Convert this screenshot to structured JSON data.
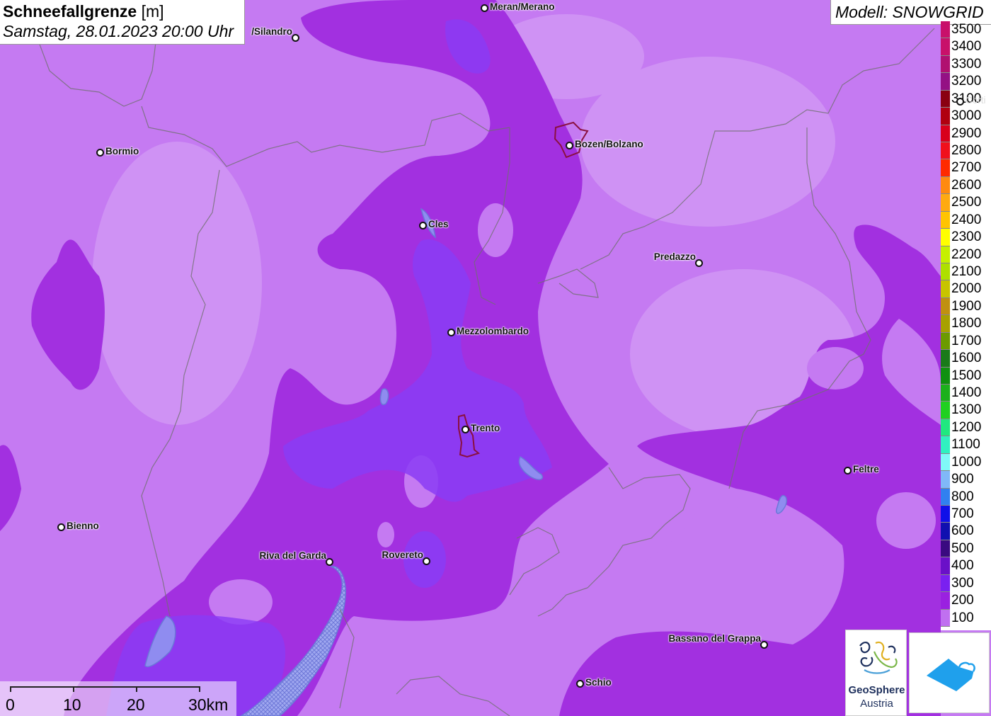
{
  "title": {
    "main": "Schneefallgrenze",
    "unit": "[m]",
    "date": "Samstag, 28.01.2023 20:00 Uhr"
  },
  "model_label": "Modell: SNOWGRID",
  "legend": [
    {
      "label": "3500",
      "color": "#c8106a"
    },
    {
      "label": "3400",
      "color": "#c8106a"
    },
    {
      "label": "3300",
      "color": "#b01070"
    },
    {
      "label": "3200",
      "color": "#941084"
    },
    {
      "label": "3100",
      "color": "#8a0010"
    },
    {
      "label": "3000",
      "color": "#b00010"
    },
    {
      "label": "2900",
      "color": "#d8001c"
    },
    {
      "label": "2800",
      "color": "#f0101c"
    },
    {
      "label": "2700",
      "color": "#ff2a00"
    },
    {
      "label": "2600",
      "color": "#ff8a10"
    },
    {
      "label": "2500",
      "color": "#ffaa10"
    },
    {
      "label": "2400",
      "color": "#ffc400"
    },
    {
      "label": "2300",
      "color": "#ffff00"
    },
    {
      "label": "2200",
      "color": "#c6f000"
    },
    {
      "label": "2100",
      "color": "#aee000"
    },
    {
      "label": "2000",
      "color": "#c8c400"
    },
    {
      "label": "1900",
      "color": "#c09010"
    },
    {
      "label": "1800",
      "color": "#a8a000"
    },
    {
      "label": "1700",
      "color": "#6c9a00"
    },
    {
      "label": "1600",
      "color": "#1a7a1a"
    },
    {
      "label": "1500",
      "color": "#109010"
    },
    {
      "label": "1400",
      "color": "#1cb01c"
    },
    {
      "label": "1300",
      "color": "#20d020"
    },
    {
      "label": "1200",
      "color": "#20e880"
    },
    {
      "label": "1100",
      "color": "#30f0c0"
    },
    {
      "label": "1000",
      "color": "#80f8f8"
    },
    {
      "label": "900",
      "color": "#80b8f8"
    },
    {
      "label": "800",
      "color": "#3080f0"
    },
    {
      "label": "700",
      "color": "#1010e8"
    },
    {
      "label": "600",
      "color": "#1010b0"
    },
    {
      "label": "500",
      "color": "#3a0a80"
    },
    {
      "label": "400",
      "color": "#6a10c8"
    },
    {
      "label": "300",
      "color": "#7a20f0"
    },
    {
      "label": "200",
      "color": "#9a20e0"
    },
    {
      "label": "100",
      "color": "#c070f0"
    }
  ],
  "cities": [
    {
      "name": "Meran/Merano"
    },
    {
      "name": "/Silandro"
    },
    {
      "name": "Bormio"
    },
    {
      "name": "Bozen/Bolzano"
    },
    {
      "name": "Cles"
    },
    {
      "name": "Predazzo"
    },
    {
      "name": "Mezzolombardo"
    },
    {
      "name": "Trento"
    },
    {
      "name": "Feltre"
    },
    {
      "name": "Bienno"
    },
    {
      "name": "Riva del Garda"
    },
    {
      "name": "Rovereto"
    },
    {
      "name": "Bassano del Grappa"
    },
    {
      "name": "Schio"
    },
    {
      "name": "Corti"
    }
  ],
  "scalebar": {
    "labels": [
      "0",
      "10",
      "20",
      "30km"
    ]
  },
  "logo": {
    "line1": "GeoSphere",
    "line2": "Austria"
  },
  "colors": {
    "level_100": "#c57af2",
    "level_200": "#a230e0",
    "level_300": "#8a3cf5",
    "water": "#7c8ee0"
  }
}
